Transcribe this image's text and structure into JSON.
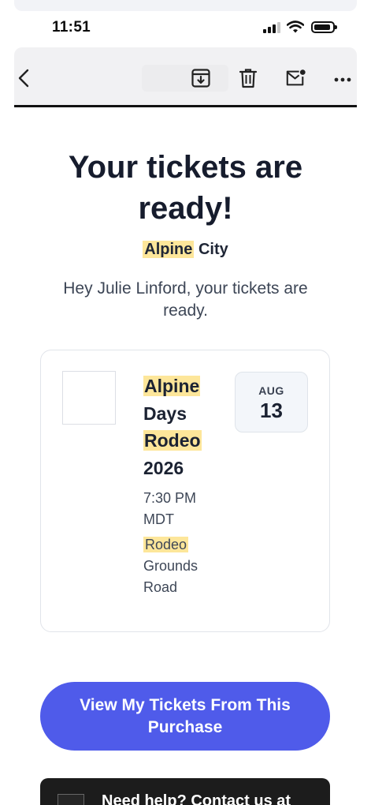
{
  "status_bar": {
    "time": "11:51"
  },
  "toolbar": {
    "back_icon": "chevron-left-icon",
    "archive_icon": "archive-icon",
    "delete_icon": "trash-icon",
    "mark_unread_icon": "mail-unread-icon",
    "more_icon": "more-horizontal-icon"
  },
  "email": {
    "headline": "Your tickets are ready!",
    "org_highlight": "Alpine",
    "org_rest": " City",
    "greeting": "Hey Julie Linford, your tickets are ready.",
    "ticket": {
      "name_word1": "Alpine",
      "name_word2": "Days",
      "name_word3": "Rodeo",
      "name_word4": "2026",
      "time": "7:30 PM MDT",
      "venue_highlight": "Rodeo",
      "venue_rest": " Grounds Road",
      "month": "AUG",
      "day": "13"
    },
    "cta_label": "View My Tickets From This Purchase",
    "help_text": "Need help? Contact us at"
  },
  "colors": {
    "accent": "#4f5bea",
    "highlight": "#fde69a",
    "heading": "#161c2d"
  }
}
